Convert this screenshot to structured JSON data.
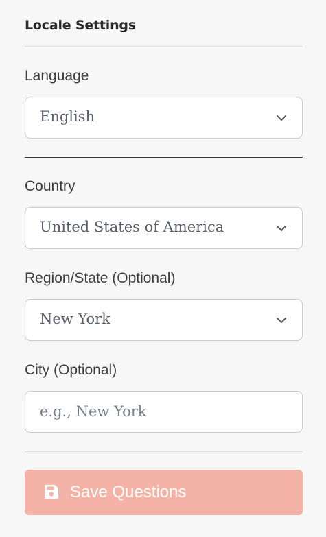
{
  "section": {
    "title": "Locale Settings"
  },
  "language": {
    "label": "Language",
    "value": "English"
  },
  "country": {
    "label": "Country",
    "value": "United States of America"
  },
  "region": {
    "label": "Region/State (Optional)",
    "value": "New York"
  },
  "city": {
    "label": "City (Optional)",
    "placeholder": "e.g., New York"
  },
  "save": {
    "label": "Save Questions",
    "icon": "floppy-disk-icon"
  },
  "colors": {
    "save_button_bg": "#f4b3a6",
    "text": "#333333",
    "border": "#c9c9c9"
  }
}
